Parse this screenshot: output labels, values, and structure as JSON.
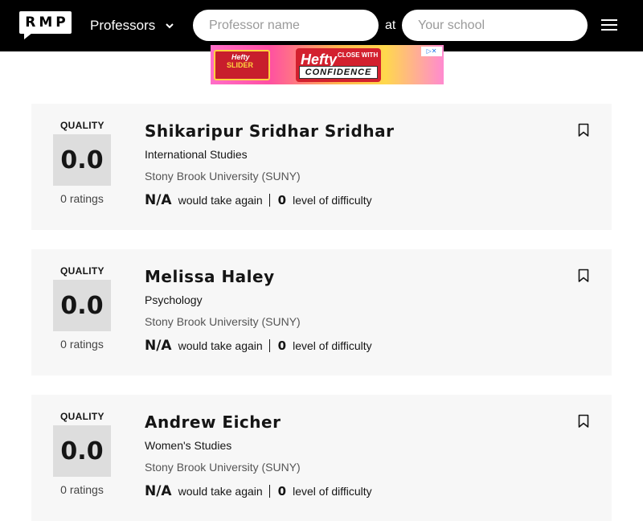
{
  "header": {
    "logo_text": "RMP",
    "search_type_label": "Professors",
    "professor_placeholder": "Professor name",
    "at_label": "at",
    "school_placeholder": "Your school",
    "icons": [
      "chevron-down-icon",
      "menu-icon",
      "bookmark-icon"
    ]
  },
  "ad": {
    "brand": "Hefty",
    "product": "Hefty",
    "product_sub": "SLIDER",
    "tagline": "CLOSE WITH",
    "slogan": "CONFIDENCE"
  },
  "labels": {
    "quality": "QUALITY",
    "would_take_again": "would take again",
    "level_of_difficulty": "level of difficulty"
  },
  "professors": [
    {
      "name": "Shikaripur Sridhar Sridhar",
      "department": "International Studies",
      "school": "Stony Brook University (SUNY)",
      "quality": "0.0",
      "ratings": "0 ratings",
      "take_again": "N/A",
      "difficulty": "0"
    },
    {
      "name": "Melissa Haley",
      "department": "Psychology",
      "school": "Stony Brook University (SUNY)",
      "quality": "0.0",
      "ratings": "0 ratings",
      "take_again": "N/A",
      "difficulty": "0"
    },
    {
      "name": "Andrew Eicher",
      "department": "Women's Studies",
      "school": "Stony Brook University (SUNY)",
      "quality": "0.0",
      "ratings": "0 ratings",
      "take_again": "N/A",
      "difficulty": "0"
    }
  ]
}
